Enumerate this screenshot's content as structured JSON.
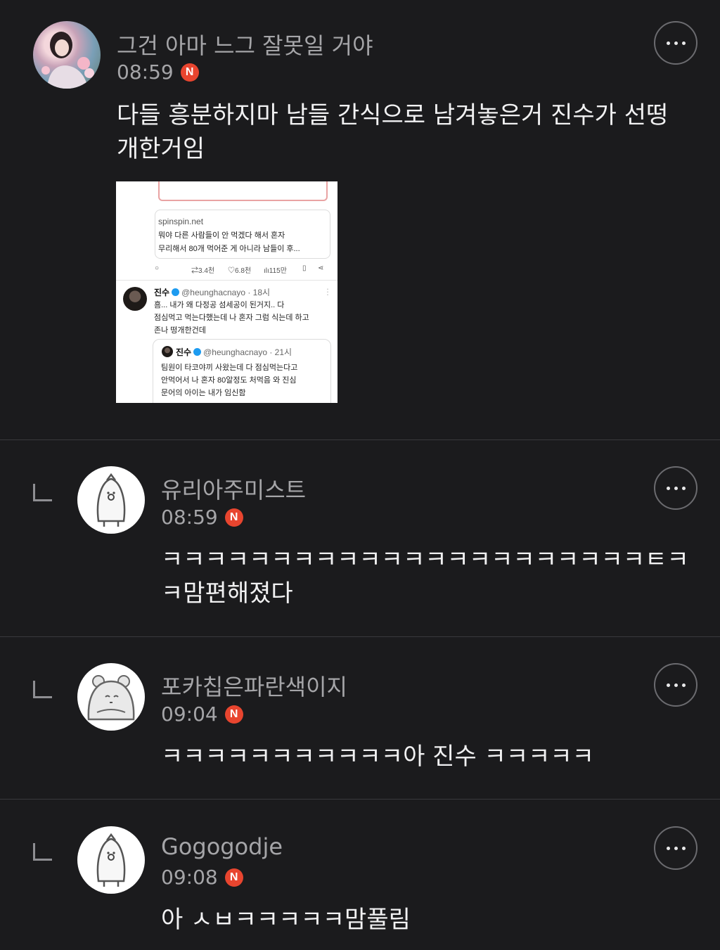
{
  "post": {
    "username": "그건 아마 느그 잘못일 거야",
    "time": "08:59",
    "badge": "N",
    "text_line1": "다들 흥분하지마 남들 간식으로 남겨놓은거 진수가 선떵",
    "text_line2": "개한거임",
    "embedded": {
      "link_domain": "spinspin.net",
      "link_line1": "뭐야 다른 사람들이 안 먹겠다 해서 혼자",
      "link_line2": "무리해서 80개 먹어준 게 아니라 남들이 후...",
      "retweets": "3.4천",
      "likes": "6.8천",
      "views": "115만",
      "tweet1": {
        "name": "진수",
        "handle": "@heunghacnayo · 18시",
        "line1": "흠... 내가 왜 다정공 섬세공이 된거지.. 다",
        "line2": "점심먹고 먹는다했는데 나 혼자 그럼 식는데 하고",
        "line3": "존나 떵개한건데"
      },
      "tweet2": {
        "name": "진수",
        "handle": "@heunghacnayo · 21시",
        "line1": "팀원이 타코야끼 사왔는데 다 점심먹는다고",
        "line2": "안먹어서 나 혼자 80알정도 처먹음 와 진심",
        "line3": "문어의 아이는 내가 임신함"
      }
    }
  },
  "replies": [
    {
      "username": "유리아주미스트",
      "time": "08:59",
      "badge": "N",
      "text_line1": "ㅋㅋㅋㅋㅋㅋㅋㅋㅋㅋㅋㅋㅋㅋㅋㅋㅋㅋㅋㅋㅋㅋㅌㅋ",
      "text_line2": "ㅋ맘편해졌다"
    },
    {
      "username": "포카칩은파란색이지",
      "time": "09:04",
      "badge": "N",
      "text_line1": "ㅋㅋㅋㅋㅋㅋㅋㅋㅋㅋㅋ아 진수 ㅋㅋㅋㅋㅋ"
    },
    {
      "username": "Gogogodje",
      "time": "09:08",
      "badge": "N",
      "text_line1": "아 ㅅㅂㅋㅋㅋㅋㅋ맘풀림"
    }
  ],
  "icons": {
    "more": "more-horizontal-icon",
    "reply": "reply-corner-icon",
    "badge": "new-badge-icon"
  },
  "colors": {
    "background": "#1b1b1d",
    "badge": "#e8452f",
    "secondary_text": "#a5a5a8"
  }
}
